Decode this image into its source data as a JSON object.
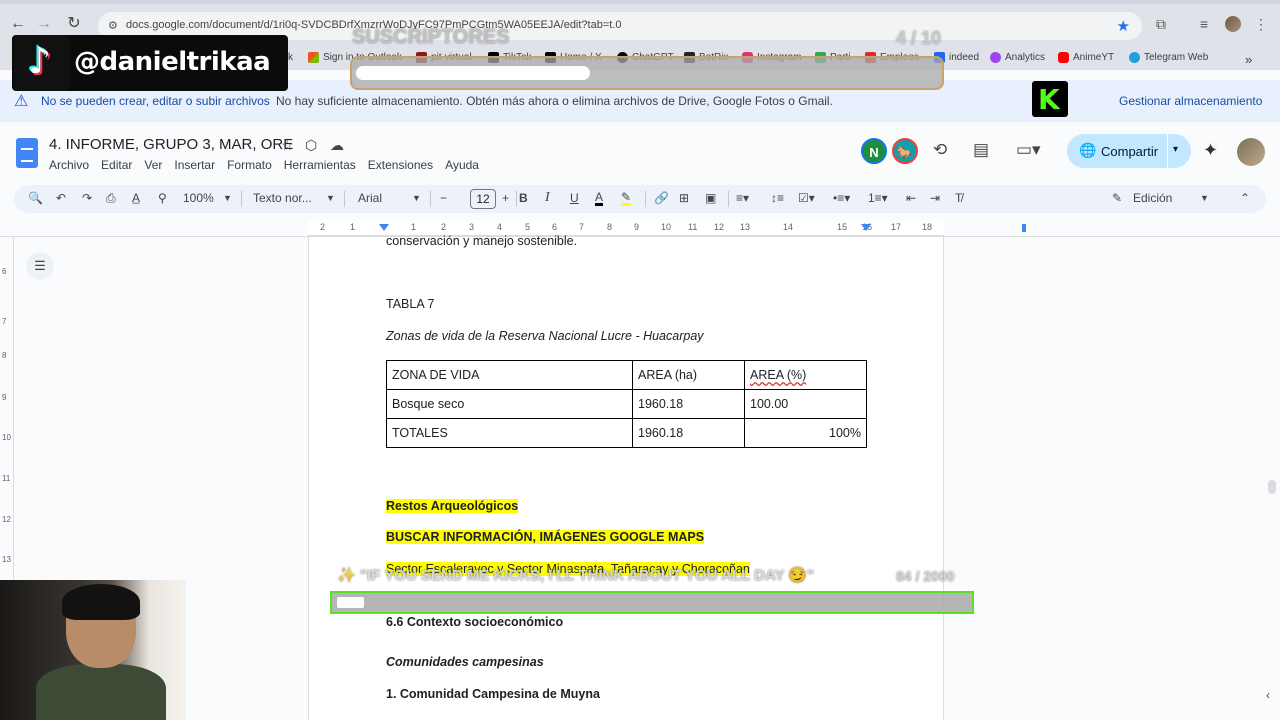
{
  "browser": {
    "url": "docs.google.com/document/d/1ri0q-SVDCBDrfXmzrrWoDJyFC97PmPCGtm5WA05EEJA/edit?tab=t.0",
    "bookmarks": [
      {
        "label": "k",
        "color": "#5f6368"
      },
      {
        "label": "Sign in to Outlook",
        "color": "#0078d4"
      },
      {
        "label": "pit-virtual",
        "color": "#8b1a1a"
      },
      {
        "label": "TikTok",
        "color": "#000000"
      },
      {
        "label": "Home / X",
        "color": "#000000"
      },
      {
        "label": "ChatGPT",
        "color": "#000000"
      },
      {
        "label": "BotRix",
        "color": "#222222"
      },
      {
        "label": "Instagram",
        "color": "#e1306c"
      },
      {
        "label": "Parti",
        "color": "#34a853"
      },
      {
        "label": "Empleos",
        "color": "#d93025"
      },
      {
        "label": "indeed",
        "color": "#2164f3"
      },
      {
        "label": "Analytics",
        "color": "#a142f4"
      },
      {
        "label": "AnimeYT",
        "color": "#ff0000"
      },
      {
        "label": "Telegram Web",
        "color": "#229ed9"
      }
    ]
  },
  "overlay": {
    "tiktok_handle": "@danieltrikaa",
    "subs_label": "SUSCRIPTORES",
    "subs_count": "4 / 10",
    "subs_progress": 0.4,
    "kicks_text": "\"IF YOU SEND ME KICKS, I'LL THINK ABOUT YOU ALL DAY 😏\"",
    "kicks_count": "84 / 2000",
    "kicks_progress": 0.042
  },
  "warning": {
    "title": "No se pueden crear, editar o subir archivos",
    "message": "No hay suficiente almacenamiento. Obtén más ahora o elimina archivos de Drive, Google Fotos o Gmail.",
    "action": "Gestionar almacenamiento"
  },
  "docs": {
    "title": "4. INFORME, GRUPO 3, MAR, ORE",
    "menu": [
      "Archivo",
      "Editar",
      "Ver",
      "Insertar",
      "Formato",
      "Herramientas",
      "Extensiones",
      "Ayuda"
    ],
    "avatars": [
      {
        "letter": "N",
        "color": "#1e8e3e"
      },
      {
        "letter": "",
        "color": "#129eaf"
      }
    ],
    "share_label": "Compartir",
    "toolbar": {
      "zoom": "100%",
      "style": "Texto nor...",
      "font": "Arial",
      "font_size": "12",
      "mode": "Edición"
    },
    "ruler_numbers": [
      "2",
      "1",
      "1",
      "2",
      "3",
      "4",
      "5",
      "6",
      "7",
      "8",
      "9",
      "10",
      "11",
      "12",
      "13",
      "14",
      "15",
      "16",
      "17",
      "18"
    ],
    "vruler_numbers": [
      "6",
      "7",
      "8",
      "9",
      "10",
      "11",
      "12",
      "13"
    ]
  },
  "document": {
    "top_fragment": "conservación y manejo sostenible.",
    "table_caption": "TABLA 7",
    "table_title": "Zonas de vida de la Reserva Nacional Lucre - Huacarpay",
    "table": {
      "headers": [
        "ZONA DE VIDA",
        "AREA (ha)",
        "AREA (%)"
      ],
      "rows": [
        [
          "Bosque seco",
          "1960.18",
          "100.00"
        ],
        [
          "TOTALES",
          "1960.18",
          "100%"
        ]
      ]
    },
    "restos": "Restos Arqueológicos",
    "buscar": "BUSCAR INFORMACIÓN, IMÁGENES GOOGLE MAPS",
    "sector": "Sector Escaleravoc y Sector Minaspata, Tañaracay y Choracoñan",
    "section_heading": "6.6 Contexto socioeconómico",
    "comunidades": "Comunidades campesinas",
    "muyna": "1. Comunidad Campesina de Muyna"
  }
}
